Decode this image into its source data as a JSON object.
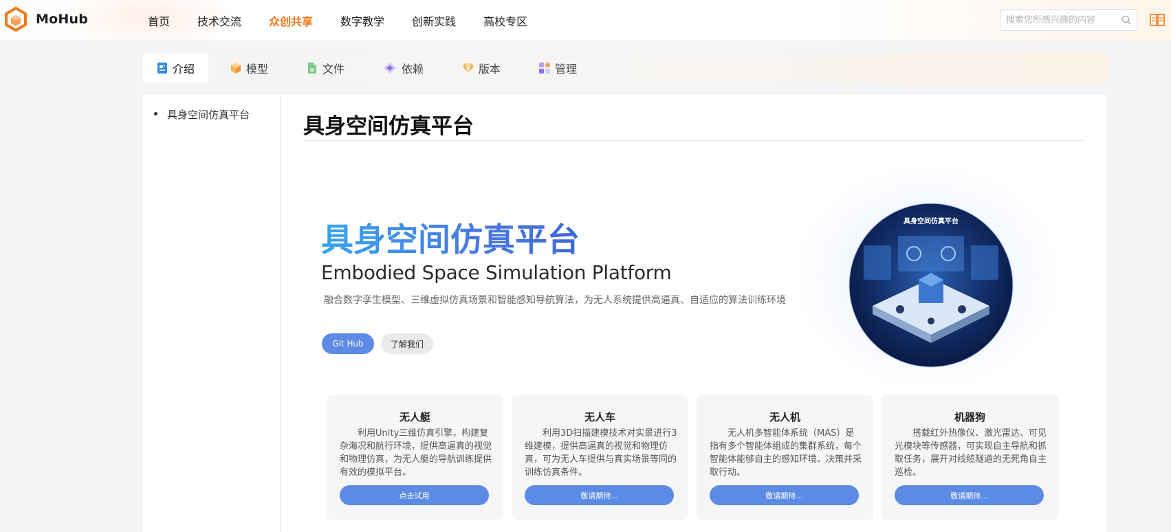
{
  "header": {
    "brand": "MoHub",
    "nav": [
      "首页",
      "技术交流",
      "众创共享",
      "数字教学",
      "创新实践",
      "高校专区"
    ],
    "active_nav": "众创共享",
    "search_placeholder": "搜索您所感兴趣的内容",
    "icons": {
      "logo": "mohub-cube-logo",
      "search": "search-icon",
      "docs": "book-icon"
    }
  },
  "tabs": [
    {
      "label": "介绍",
      "icon": "document-icon",
      "active": true
    },
    {
      "label": "模型",
      "icon": "cube-icon"
    },
    {
      "label": "文件",
      "icon": "file-icon"
    },
    {
      "label": "依赖",
      "icon": "diamond-link-icon"
    },
    {
      "label": "版本",
      "icon": "gem-icon"
    },
    {
      "label": "管理",
      "icon": "grid-icon"
    }
  ],
  "sidebar": {
    "toc": [
      "具身空间仿真平台"
    ]
  },
  "main": {
    "title": "具身空间仿真平台",
    "hero": {
      "title": "具身空间仿真平台",
      "subtitle": "Embodied Space Simulation Platform",
      "description": "融合数字孪生模型、三维虚拟仿真场景和智能感知导航算法，为无人系统提供高逼真、自适应的算法训练环境",
      "github_button": "Git Hub",
      "about_button": "了解我们",
      "image_caption": "具身空间仿真平台"
    },
    "cards": [
      {
        "title": "无人艇",
        "description": "利用Unity三维仿真引擎，构建复杂海况和航行环境，提供高逼真的视觉和物理仿真，为无人艇的导航训练提供有效的模拟平台。",
        "button": "点击试用"
      },
      {
        "title": "无人车",
        "description": "利用3D扫描建模技术对实景进行3维建模，提供高逼真的视觉和物理仿真，可为无人车提供与真实场景等同的训练仿真条件。",
        "button": "敬请期待..."
      },
      {
        "title": "无人机",
        "description": "无人机多智能体系统（MAS）是指有多个智能体组成的集群系统，每个智能体能够自主的感知环境、决策并采取行动。",
        "button": "敬请期待..."
      },
      {
        "title": "机器狗",
        "description": "搭载红外热像仪、激光雷达、可见光模块等传感器，可实现自主导航和抓取任务，展开对线缆隧道的无死角自主巡检。",
        "button": "敬请期待..."
      }
    ]
  },
  "colors": {
    "accent_orange": "#f07a1a",
    "primary_blue": "#5b8be4",
    "hero_gradient_start": "#38a5f0",
    "hero_gradient_end": "#3e6ad6"
  }
}
